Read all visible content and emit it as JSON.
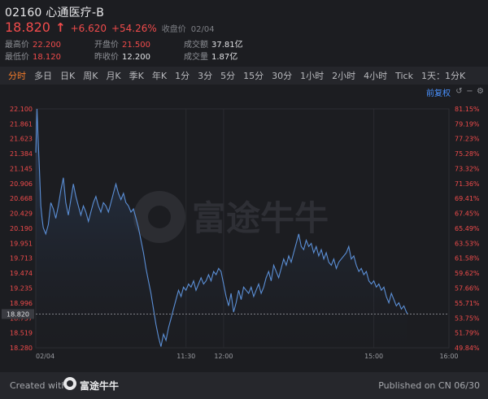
{
  "header": {
    "code": "02160",
    "name": "心通医疗-B",
    "price": "18.820",
    "change": "+6.620",
    "change_pct": "+54.26%",
    "close_label": "收盘价",
    "close_date": "02/04",
    "stats": [
      {
        "label": "最高价",
        "value": "22.200",
        "tone": "red"
      },
      {
        "label": "开盘价",
        "value": "21.500",
        "tone": "red"
      },
      {
        "label": "成交额",
        "value": "37.81亿",
        "tone": "white"
      },
      {
        "label": "最低价",
        "value": "18.120",
        "tone": "red"
      },
      {
        "label": "昨收价",
        "value": "12.200",
        "tone": "white"
      },
      {
        "label": "成交量",
        "value": "1.87亿",
        "tone": "white"
      }
    ]
  },
  "tabs": [
    "分时",
    "多日",
    "日K",
    "周K",
    "月K",
    "季K",
    "年K",
    "1分",
    "3分",
    "5分",
    "15分",
    "30分",
    "1小时",
    "2小时",
    "4小时",
    "Tick",
    "1天：1分K"
  ],
  "active_tab": "分时",
  "toolbar": {
    "adjust_label": "前复权"
  },
  "watermark": "富途牛牛",
  "chart_data": {
    "type": "area",
    "y_left_ticks": [
      "22.100",
      "21.861",
      "21.623",
      "21.384",
      "21.145",
      "20.906",
      "20.668",
      "20.429",
      "20.190",
      "19.951",
      "19.713",
      "19.474",
      "19.235",
      "18.996",
      "18.757",
      "18.519",
      "18.280"
    ],
    "y_right_ticks": [
      "81.15%",
      "79.19%",
      "77.23%",
      "75.28%",
      "73.32%",
      "71.36%",
      "69.41%",
      "67.45%",
      "65.49%",
      "63.53%",
      "61.58%",
      "59.62%",
      "57.66%",
      "55.71%",
      "53.75%",
      "51.79%",
      "49.84%"
    ],
    "x_ticks": [
      {
        "label": "02/04",
        "t": 0
      },
      {
        "label": "11:30",
        "t": 120
      },
      {
        "label": "12:00",
        "t": 150
      },
      {
        "label": "15:00",
        "t": 270
      },
      {
        "label": "16:00",
        "t": 330
      }
    ],
    "ylim": [
      18.28,
      22.1
    ],
    "xlim": [
      0,
      330
    ],
    "last_price": 18.82,
    "last_price_label": "18.820",
    "series": [
      {
        "color": "#5b8fd6",
        "points": [
          [
            0,
            21.4
          ],
          [
            1,
            22.1
          ],
          [
            2,
            21.55
          ],
          [
            3,
            21.1
          ],
          [
            4,
            20.55
          ],
          [
            5,
            20.35
          ],
          [
            6,
            20.2
          ],
          [
            8,
            20.1
          ],
          [
            10,
            20.25
          ],
          [
            12,
            20.6
          ],
          [
            14,
            20.5
          ],
          [
            16,
            20.35
          ],
          [
            18,
            20.55
          ],
          [
            20,
            20.8
          ],
          [
            22,
            21.0
          ],
          [
            24,
            20.6
          ],
          [
            26,
            20.4
          ],
          [
            28,
            20.65
          ],
          [
            30,
            20.9
          ],
          [
            32,
            20.7
          ],
          [
            34,
            20.55
          ],
          [
            36,
            20.4
          ],
          [
            38,
            20.55
          ],
          [
            40,
            20.45
          ],
          [
            42,
            20.3
          ],
          [
            44,
            20.45
          ],
          [
            46,
            20.6
          ],
          [
            48,
            20.7
          ],
          [
            50,
            20.55
          ],
          [
            52,
            20.45
          ],
          [
            54,
            20.6
          ],
          [
            56,
            20.55
          ],
          [
            58,
            20.45
          ],
          [
            60,
            20.6
          ],
          [
            62,
            20.75
          ],
          [
            64,
            20.9
          ],
          [
            66,
            20.75
          ],
          [
            68,
            20.65
          ],
          [
            70,
            20.75
          ],
          [
            72,
            20.6
          ],
          [
            74,
            20.55
          ],
          [
            76,
            20.45
          ],
          [
            78,
            20.5
          ],
          [
            80,
            20.35
          ],
          [
            82,
            20.2
          ],
          [
            84,
            20.0
          ],
          [
            86,
            19.8
          ],
          [
            88,
            19.55
          ],
          [
            90,
            19.35
          ],
          [
            92,
            19.15
          ],
          [
            94,
            18.9
          ],
          [
            96,
            18.65
          ],
          [
            98,
            18.45
          ],
          [
            100,
            18.3
          ],
          [
            102,
            18.5
          ],
          [
            104,
            18.4
          ],
          [
            106,
            18.6
          ],
          [
            108,
            18.75
          ],
          [
            110,
            18.9
          ],
          [
            112,
            19.05
          ],
          [
            114,
            19.2
          ],
          [
            116,
            19.1
          ],
          [
            118,
            19.25
          ],
          [
            120,
            19.2
          ],
          [
            122,
            19.3
          ],
          [
            124,
            19.25
          ],
          [
            126,
            19.35
          ],
          [
            128,
            19.2
          ],
          [
            130,
            19.3
          ],
          [
            132,
            19.4
          ],
          [
            134,
            19.3
          ],
          [
            136,
            19.35
          ],
          [
            138,
            19.45
          ],
          [
            140,
            19.35
          ],
          [
            142,
            19.5
          ],
          [
            144,
            19.45
          ],
          [
            146,
            19.55
          ],
          [
            148,
            19.5
          ],
          [
            150,
            19.3
          ],
          [
            152,
            19.1
          ],
          [
            154,
            18.95
          ],
          [
            156,
            19.15
          ],
          [
            158,
            18.85
          ],
          [
            160,
            19.0
          ],
          [
            162,
            19.2
          ],
          [
            164,
            19.05
          ],
          [
            166,
            19.25
          ],
          [
            168,
            19.2
          ],
          [
            170,
            19.15
          ],
          [
            172,
            19.25
          ],
          [
            174,
            19.1
          ],
          [
            176,
            19.2
          ],
          [
            178,
            19.3
          ],
          [
            180,
            19.15
          ],
          [
            182,
            19.25
          ],
          [
            184,
            19.4
          ],
          [
            186,
            19.5
          ],
          [
            188,
            19.35
          ],
          [
            190,
            19.6
          ],
          [
            192,
            19.5
          ],
          [
            194,
            19.4
          ],
          [
            196,
            19.55
          ],
          [
            198,
            19.7
          ],
          [
            200,
            19.6
          ],
          [
            202,
            19.75
          ],
          [
            204,
            19.65
          ],
          [
            206,
            19.8
          ],
          [
            208,
            19.95
          ],
          [
            210,
            20.1
          ],
          [
            212,
            19.9
          ],
          [
            214,
            19.85
          ],
          [
            216,
            20.0
          ],
          [
            218,
            19.9
          ],
          [
            220,
            19.95
          ],
          [
            222,
            19.8
          ],
          [
            224,
            19.9
          ],
          [
            226,
            19.75
          ],
          [
            228,
            19.85
          ],
          [
            230,
            19.7
          ],
          [
            232,
            19.8
          ],
          [
            234,
            19.65
          ],
          [
            236,
            19.6
          ],
          [
            238,
            19.7
          ],
          [
            240,
            19.55
          ],
          [
            242,
            19.65
          ],
          [
            244,
            19.7
          ],
          [
            246,
            19.75
          ],
          [
            248,
            19.8
          ],
          [
            250,
            19.9
          ],
          [
            252,
            19.7
          ],
          [
            254,
            19.75
          ],
          [
            256,
            19.6
          ],
          [
            258,
            19.5
          ],
          [
            260,
            19.55
          ],
          [
            262,
            19.45
          ],
          [
            264,
            19.5
          ],
          [
            266,
            19.35
          ],
          [
            268,
            19.3
          ],
          [
            270,
            19.35
          ],
          [
            272,
            19.25
          ],
          [
            274,
            19.3
          ],
          [
            276,
            19.2
          ],
          [
            278,
            19.25
          ],
          [
            280,
            19.1
          ],
          [
            282,
            19.0
          ],
          [
            284,
            19.15
          ],
          [
            286,
            19.05
          ],
          [
            288,
            18.95
          ],
          [
            290,
            19.0
          ],
          [
            292,
            18.9
          ],
          [
            294,
            18.95
          ],
          [
            296,
            18.85
          ],
          [
            297,
            18.82
          ]
        ]
      }
    ]
  },
  "footer": {
    "created_with": "Created with",
    "brand": "富途牛牛",
    "published": "Published on CN 06/30"
  }
}
